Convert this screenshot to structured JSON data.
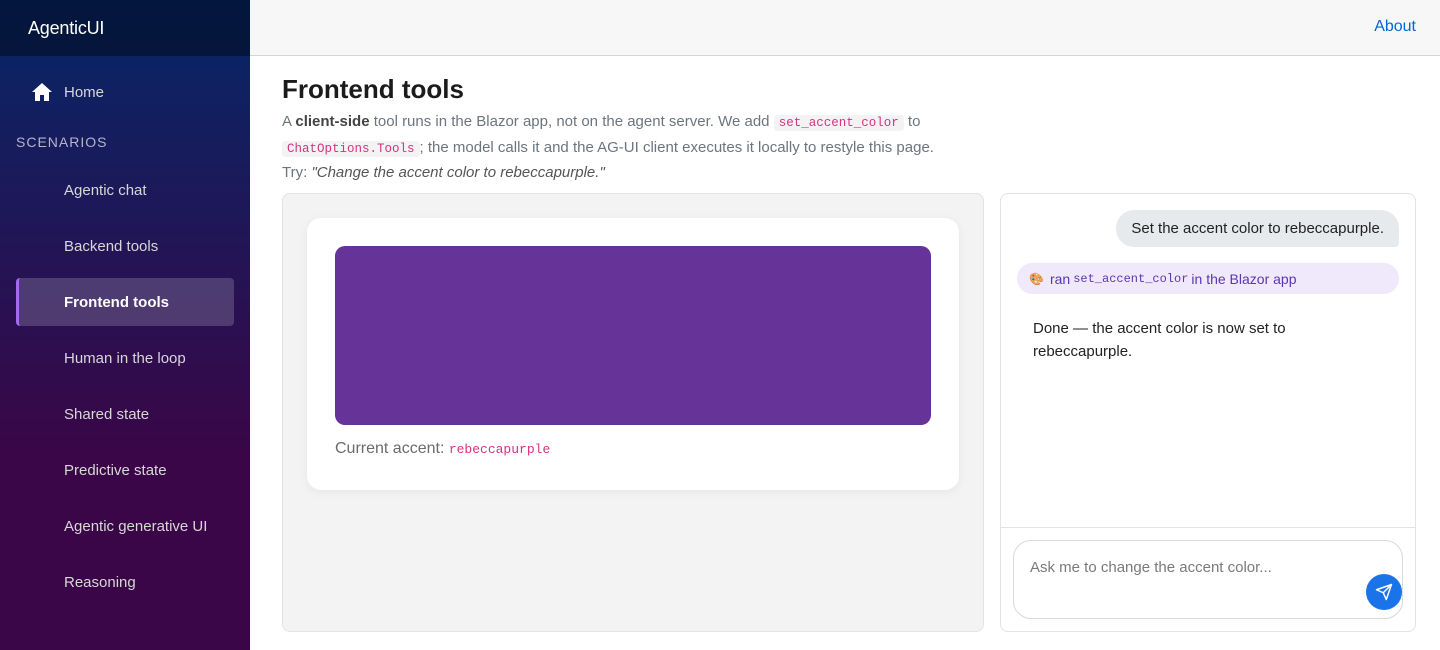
{
  "app": {
    "brand": "AgenticUI"
  },
  "topbar": {
    "about_label": "About"
  },
  "sidebar": {
    "home_label": "Home",
    "section_label": "SCENARIOS",
    "items": [
      {
        "label": "Agentic chat"
      },
      {
        "label": "Backend tools"
      },
      {
        "label": "Frontend tools"
      },
      {
        "label": "Human in the loop"
      },
      {
        "label": "Shared state"
      },
      {
        "label": "Predictive state"
      },
      {
        "label": "Agentic generative UI"
      },
      {
        "label": "Reasoning"
      }
    ],
    "active_item": "Frontend tools"
  },
  "page": {
    "title": "Frontend tools",
    "intro_a": "A ",
    "intro_bold": "client-side",
    "intro_b": " tool runs in the Blazor app, not on the agent server. We add ",
    "code_tool": "set_accent_color",
    "intro_c": " to ",
    "code_options": "ChatOptions.Tools",
    "intro_d": "; the model calls it and the AG-UI client executes it locally to restyle this page.",
    "try_label": "Try: ",
    "try_example": "\"Change the accent color to rebeccapurple.\""
  },
  "demo": {
    "accent_color": "#663399",
    "current_accent_label": "Current accent: ",
    "current_accent_value": "rebeccapurple"
  },
  "chat": {
    "user_message": "Set the accent color to rebeccapurple.",
    "tool_ran_prefix": "ran",
    "tool_name": "set_accent_color",
    "tool_ran_suffix": "in the Blazor app",
    "assistant_message": "Done — the accent color is now set to rebeccapurple.",
    "input_placeholder": "Ask me to change the accent color...",
    "input_value": ""
  },
  "colors": {
    "send_button": "#1a73e8",
    "link": "#0366d6",
    "active_border": "#a46af0"
  }
}
